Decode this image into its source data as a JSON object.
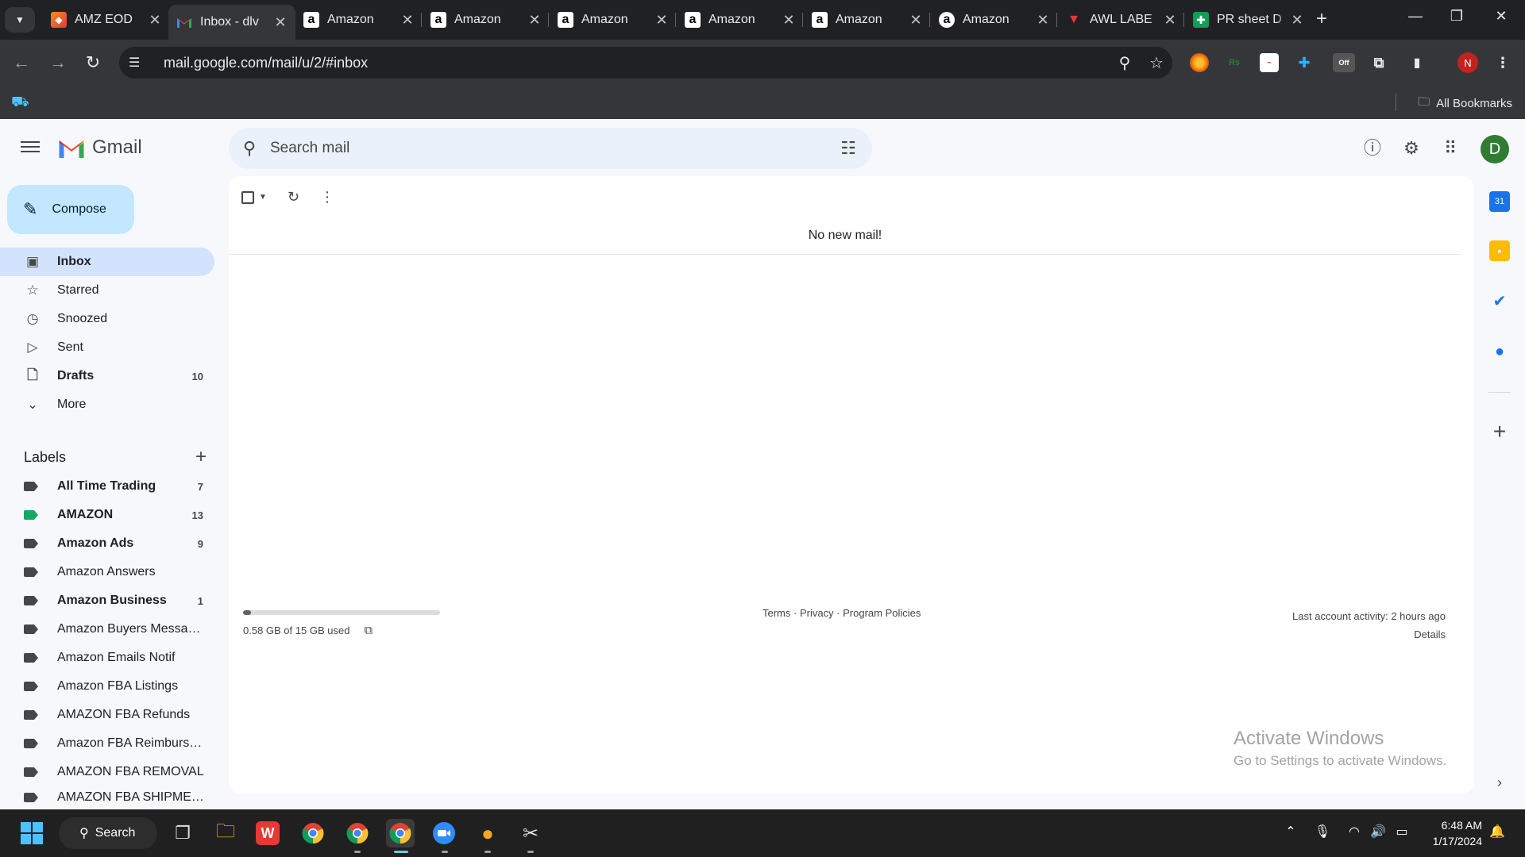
{
  "browser": {
    "tabs": [
      {
        "title": "AMZ EOD",
        "favicon": "orange-diamond-icon",
        "active": false
      },
      {
        "title": "Inbox - dlv",
        "favicon": "gmail-icon",
        "active": true
      },
      {
        "title": "Amazon",
        "favicon": "amazon-a-icon",
        "active": false
      },
      {
        "title": "Amazon",
        "favicon": "amazon-a-icon",
        "active": false
      },
      {
        "title": "Amazon",
        "favicon": "amazon-a-icon",
        "active": false
      },
      {
        "title": "Amazon",
        "favicon": "amazon-a-icon",
        "active": false
      },
      {
        "title": "Amazon",
        "favicon": "amazon-a-icon",
        "active": false
      },
      {
        "title": "Amazon",
        "favicon": "amazon-circle-icon",
        "active": false
      },
      {
        "title": "AWL LABE",
        "favicon": "red-shield-icon",
        "active": false
      },
      {
        "title": "PR sheet D",
        "favicon": "sheets-icon",
        "active": false
      }
    ],
    "url": "mail.google.com/mail/u/2/#inbox",
    "profile_initial": "N",
    "bookmarks_label": "All Bookmarks",
    "extension_off_badge": "Off",
    "extension_rs_label": "Rs"
  },
  "gmail": {
    "logo_text": "Gmail",
    "search_placeholder": "Search mail",
    "user_initial": "D",
    "compose_label": "Compose",
    "nav": [
      {
        "label": "Inbox",
        "icon": "inbox-icon",
        "count": "",
        "active": true
      },
      {
        "label": "Starred",
        "icon": "star-icon",
        "count": ""
      },
      {
        "label": "Snoozed",
        "icon": "clock-icon",
        "count": ""
      },
      {
        "label": "Sent",
        "icon": "send-icon",
        "count": ""
      },
      {
        "label": "Drafts",
        "icon": "draft-icon",
        "count": "10"
      },
      {
        "label": "More",
        "icon": "chevron-down-icon",
        "count": ""
      }
    ],
    "labels_heading": "Labels",
    "labels": [
      {
        "name": "All Time Trading",
        "count": "7",
        "bold": true,
        "color": "#444746"
      },
      {
        "name": "AMAZON",
        "count": "13",
        "bold": true,
        "color": "#16a765"
      },
      {
        "name": "Amazon Ads",
        "count": "9",
        "bold": true,
        "color": "#444746"
      },
      {
        "name": "Amazon Answers",
        "count": "",
        "bold": false,
        "color": "#444746"
      },
      {
        "name": "Amazon Business",
        "count": "1",
        "bold": true,
        "color": "#444746"
      },
      {
        "name": "Amazon Buyers Messag...",
        "count": "",
        "bold": false,
        "color": "#444746"
      },
      {
        "name": "Amazon Emails Notif",
        "count": "",
        "bold": false,
        "color": "#444746"
      },
      {
        "name": "Amazon FBA Listings",
        "count": "",
        "bold": false,
        "color": "#444746"
      },
      {
        "name": "AMAZON FBA Refunds",
        "count": "",
        "bold": false,
        "color": "#444746"
      },
      {
        "name": "Amazon FBA Reimburse...",
        "count": "",
        "bold": false,
        "color": "#444746"
      },
      {
        "name": "AMAZON FBA REMOVAL",
        "count": "",
        "bold": false,
        "color": "#444746"
      },
      {
        "name": "AMAZON FBA SHIPMEN...",
        "count": "",
        "bold": false,
        "color": "#444746"
      }
    ],
    "empty_message": "No new mail!",
    "storage_text": "0.58 GB of 15 GB used",
    "storage_fraction": 0.039,
    "footer_links": "Terms · Privacy · Program Policies",
    "last_activity": "Last account activity: 2 hours ago",
    "details_link": "Details",
    "watermark_title": "Activate Windows",
    "watermark_sub": "Go to Settings to activate Windows."
  },
  "taskbar": {
    "search_label": "Search",
    "time": "6:48 AM",
    "date": "1/17/2024"
  }
}
